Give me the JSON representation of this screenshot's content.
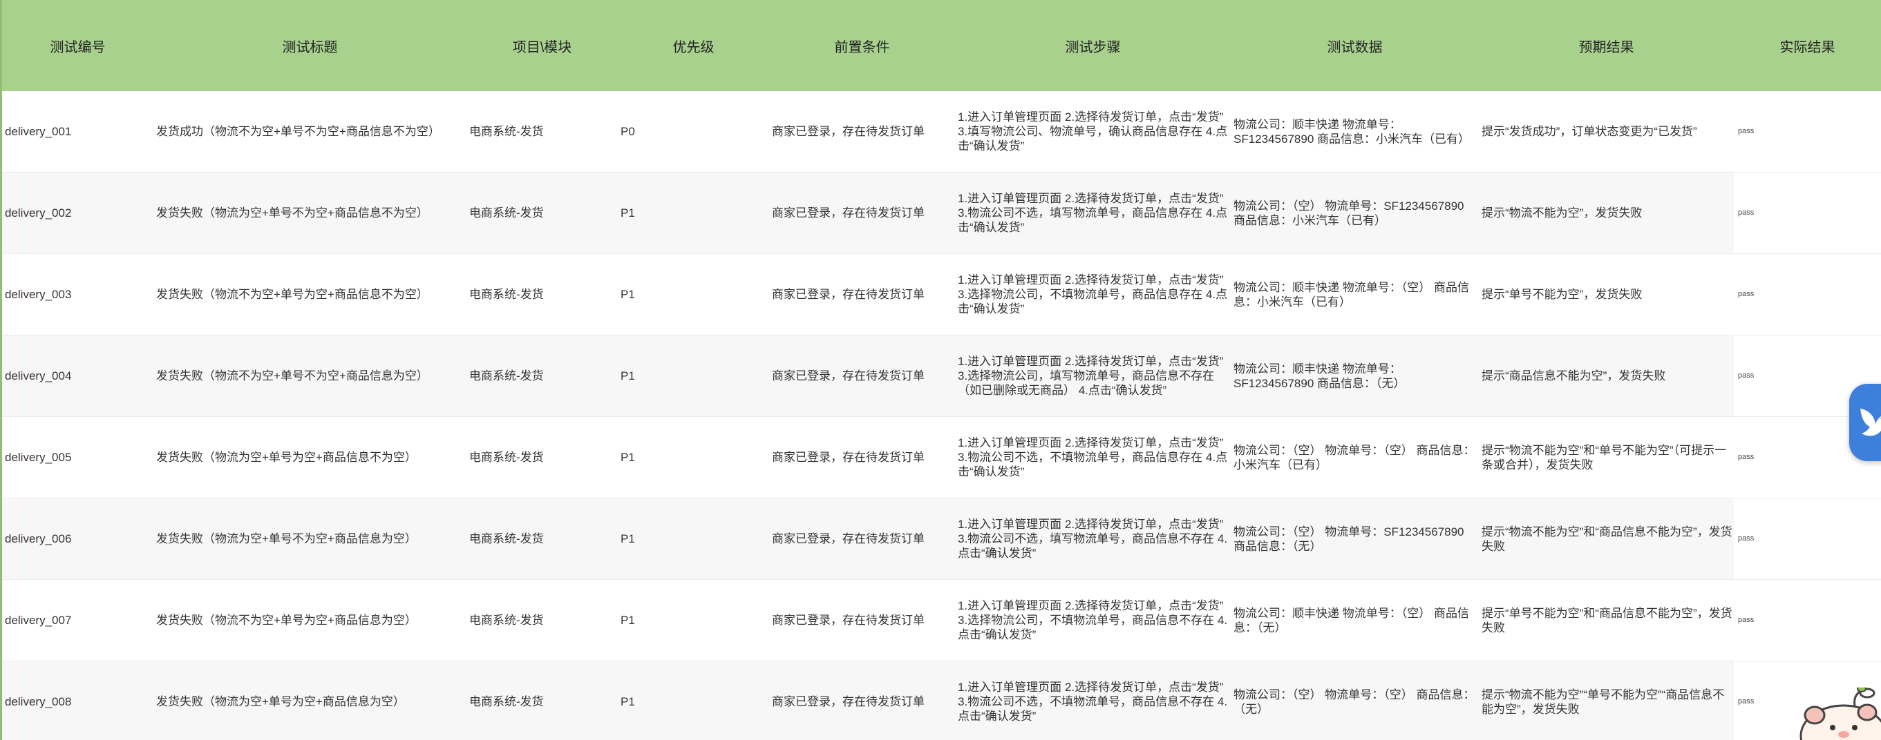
{
  "table": {
    "headers": [
      "测试编号",
      "测试标题",
      "项目\\模块",
      "优先级",
      "前置条件",
      "测试步骤",
      "测试数据",
      "预期结果",
      "实际结果"
    ],
    "rows": [
      {
        "id": "delivery_001",
        "title": "发货成功（物流不为空+单号不为空+商品信息不为空）",
        "module": "电商系统-发货",
        "priority": "P0",
        "precondition": "商家已登录，存在待发货订单",
        "steps": "1.进入订单管理页面 2.选择待发货订单，点击“发货” 3.填写物流公司、物流单号，确认商品信息存在 4.点击“确认发货”",
        "data": "物流公司：顺丰快递 物流单号：SF1234567890 商品信息：小米汽车（已有）",
        "expected": "提示“发货成功”，订单状态变更为“已发货”",
        "actual": "pass"
      },
      {
        "id": "delivery_002",
        "title": "发货失败（物流为空+单号不为空+商品信息不为空）",
        "module": "电商系统-发货",
        "priority": "P1",
        "precondition": "商家已登录，存在待发货订单",
        "steps": "1.进入订单管理页面 2.选择待发货订单，点击“发货” 3.物流公司不选，填写物流单号，商品信息存在 4.点击“确认发货”",
        "data": "物流公司：（空） 物流单号：SF1234567890 商品信息：小米汽车（已有）",
        "expected": "提示“物流不能为空”，发货失败",
        "actual": "pass"
      },
      {
        "id": "delivery_003",
        "title": "发货失败（物流不为空+单号为空+商品信息不为空）",
        "module": "电商系统-发货",
        "priority": "P1",
        "precondition": "商家已登录，存在待发货订单",
        "steps": "1.进入订单管理页面 2.选择待发货订单，点击“发货” 3.选择物流公司，不填物流单号，商品信息存在 4.点击“确认发货”",
        "data": "物流公司：顺丰快递 物流单号：（空） 商品信息：小米汽车（已有）",
        "expected": "提示“单号不能为空”，发货失败",
        "actual": "pass"
      },
      {
        "id": "delivery_004",
        "title": "发货失败（物流不为空+单号不为空+商品信息为空）",
        "module": "电商系统-发货",
        "priority": "P1",
        "precondition": "商家已登录，存在待发货订单",
        "steps": "1.进入订单管理页面 2.选择待发货订单，点击“发货” 3.选择物流公司，填写物流单号，商品信息不存在（如已删除或无商品） 4.点击“确认发货”",
        "data": "物流公司：顺丰快递 物流单号：SF1234567890 商品信息：（无）",
        "expected": "提示“商品信息不能为空”，发货失败",
        "actual": "pass"
      },
      {
        "id": "delivery_005",
        "title": "发货失败（物流为空+单号为空+商品信息不为空）",
        "module": "电商系统-发货",
        "priority": "P1",
        "precondition": "商家已登录，存在待发货订单",
        "steps": "1.进入订单管理页面 2.选择待发货订单，点击“发货” 3.物流公司不选，不填物流单号，商品信息存在 4.点击“确认发货”",
        "data": "物流公司：（空） 物流单号：（空） 商品信息：小米汽车（已有）",
        "expected": "提示“物流不能为空”和“单号不能为空”（可提示一条或合并），发货失败",
        "actual": "pass"
      },
      {
        "id": "delivery_006",
        "title": "发货失败（物流为空+单号不为空+商品信息为空）",
        "module": "电商系统-发货",
        "priority": "P1",
        "precondition": "商家已登录，存在待发货订单",
        "steps": "1.进入订单管理页面 2.选择待发货订单，点击“发货” 3.物流公司不选，填写物流单号，商品信息不存在 4.点击“确认发货”",
        "data": "物流公司：（空） 物流单号：SF1234567890 商品信息：（无）",
        "expected": "提示“物流不能为空”和“商品信息不能为空”，发货失败",
        "actual": "pass"
      },
      {
        "id": "delivery_007",
        "title": "发货失败（物流不为空+单号为空+商品信息为空）",
        "module": "电商系统-发货",
        "priority": "P1",
        "precondition": "商家已登录，存在待发货订单",
        "steps": "1.进入订单管理页面 2.选择待发货订单，点击“发货” 3.选择物流公司，不填物流单号，商品信息不存在 4.点击“确认发货”",
        "data": "物流公司：顺丰快递 物流单号：（空） 商品信息：（无）",
        "expected": "提示“单号不能为空”和“商品信息不能为空”，发货失败",
        "actual": "pass"
      },
      {
        "id": "delivery_008",
        "title": "发货失败（物流为空+单号为空+商品信息为空）",
        "module": "电商系统-发货",
        "priority": "P1",
        "precondition": "商家已登录，存在待发货订单",
        "steps": "1.进入订单管理页面 2.选择待发货订单，点击“发货” 3.物流公司不选，不填物流单号，商品信息不存在 4.点击“确认发货”",
        "data": "物流公司：（空） 物流单号：（空） 商品信息：（无）",
        "expected": "提示“物流不能为空”“单号不能为空”“商品信息不能为空”，发货失败",
        "actual": "pass"
      }
    ]
  },
  "colors": {
    "header_bg": "#a9d18e",
    "row_alt_bg": "#f7f7f7",
    "accent": "#2e7d32",
    "badge": "#3f7fdc"
  },
  "icons": {
    "floating_badge": "bird-icon",
    "mascot": "mascot-icon"
  }
}
